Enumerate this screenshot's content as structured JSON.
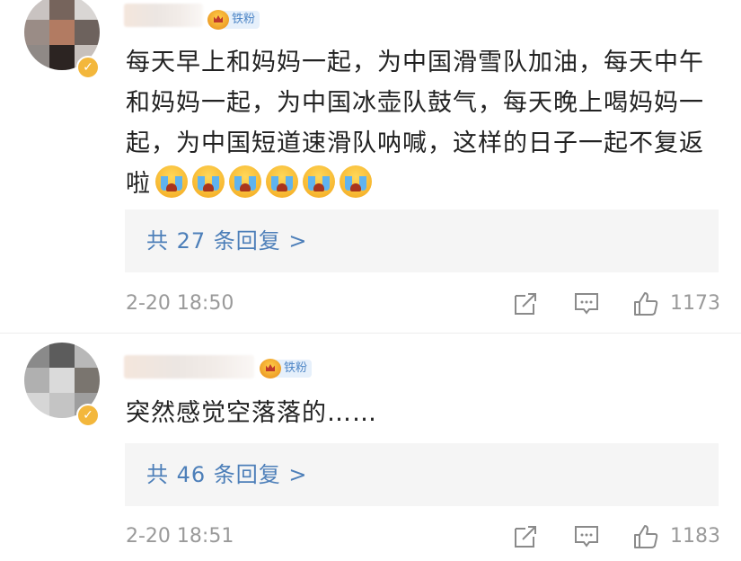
{
  "comments": [
    {
      "badge": "铁粉",
      "text": "每天早上和妈妈一起，为中国滑雪队加油，每天中午和妈妈一起，为中国冰壶队鼓气，每天晚上喝妈妈一起，为中国短道速滑队呐喊，这样的日子一起不复返啦",
      "emoji_count": 6,
      "replies": "共 27 条回复 >",
      "time": "2-20 18:50",
      "likes": "1173"
    },
    {
      "badge": "铁粉",
      "text": "突然感觉空落落的……",
      "replies": "共 46 条回复 >",
      "time": "2-20 18:51",
      "likes": "1183"
    }
  ],
  "icons": {
    "share": "share-icon",
    "comment": "comment-icon",
    "like": "like-icon"
  },
  "colors": {
    "link": "#4d7fb9",
    "meta": "#9a9a9a",
    "badge_bg": "#e6f0fb",
    "badge_text": "#4e86c6"
  }
}
